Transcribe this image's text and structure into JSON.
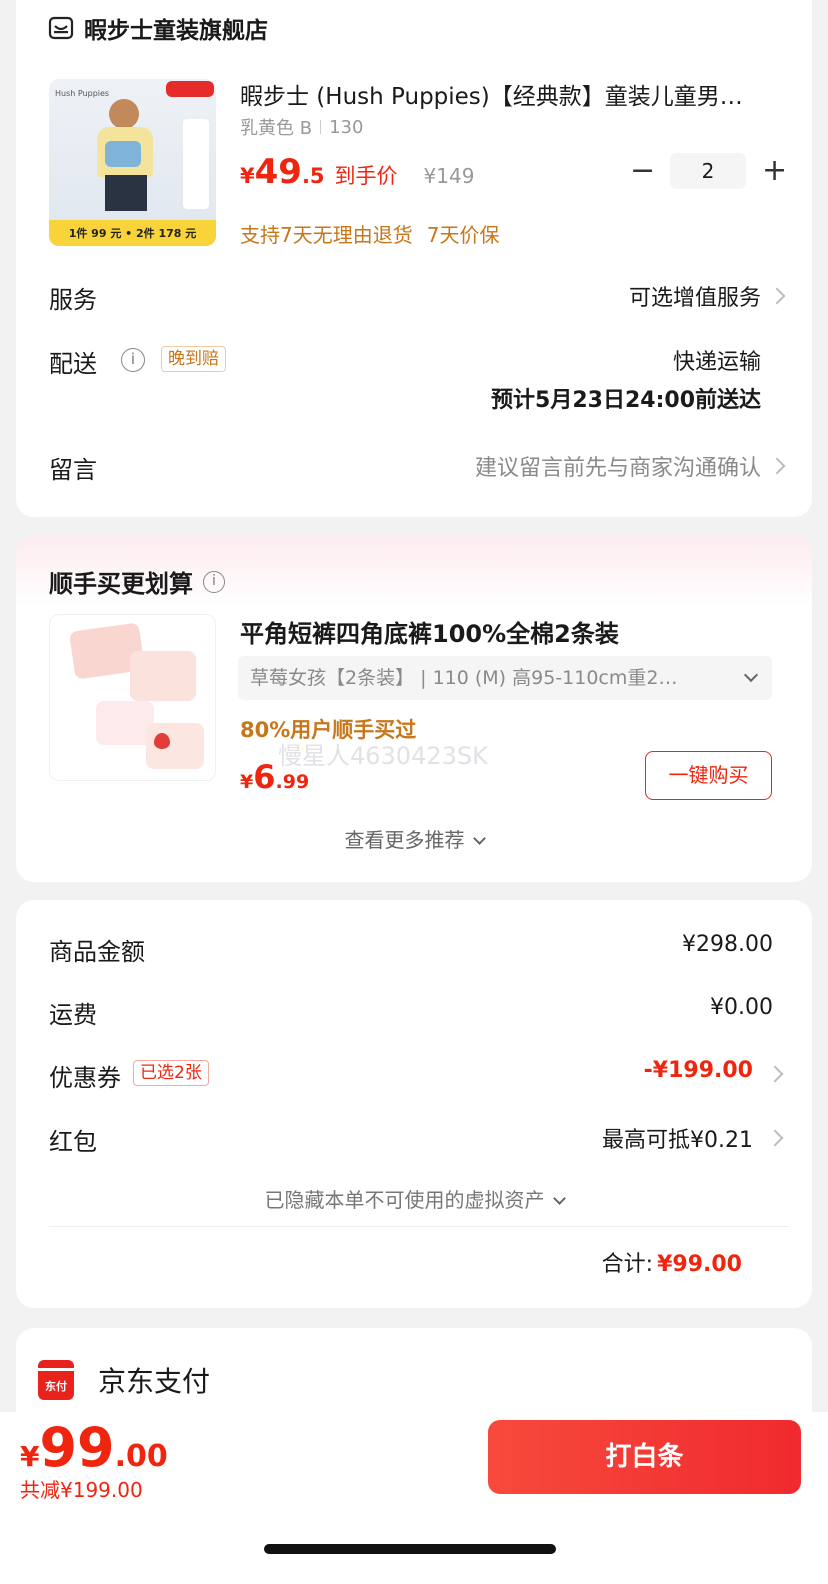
{
  "store": {
    "name": "暇步士童装旗舰店",
    "store_icon": "store-icon"
  },
  "product": {
    "brand_logo_text": "Hush Puppies",
    "promo_text": "1件 99 元 • 2件 178 元",
    "title": "暇步士 (Hush Puppies)【经典款】童装儿童男…",
    "variant": "乳黄色 B",
    "size": "130",
    "price_symbol": "¥",
    "price_int": "49",
    "price_dec": ".5",
    "price_label": "到手价",
    "original_price": "¥149",
    "quantity": "2",
    "qty_minus": "−",
    "qty_plus": "+",
    "guarantee_1": "支持7天无理由退货",
    "guarantee_2": "7天价保"
  },
  "service": {
    "label": "服务",
    "value": "可选增值服务"
  },
  "delivery": {
    "label": "配送",
    "badge": "晚到赔",
    "method": "快递运输",
    "eta": "预计5月23日24:00前送达"
  },
  "message": {
    "label": "留言",
    "placeholder": "建议留言前先与商家沟通确认"
  },
  "addon": {
    "title": "顺手买更划算",
    "product_title": "平角短裤四角底裤100%全棉2条装",
    "spec": "草莓女孩【2条装】 | 110 (M) 高95-110cm重2…",
    "popularity": "80%用户顺手买过",
    "price_symbol": "¥",
    "price_int": "6",
    "price_dec": ".99",
    "buy_button": "一键购买",
    "watermark": "慢星人4630423SK",
    "more": "查看更多推荐"
  },
  "summary": {
    "goods_label": "商品金额",
    "goods_value": "¥298.00",
    "shipping_label": "运费",
    "shipping_value": "¥0.00",
    "coupon_label": "优惠券",
    "coupon_badge": "已选2张",
    "coupon_value": "-¥199.00",
    "redpacket_label": "红包",
    "redpacket_value": "最高可抵¥0.21",
    "hidden_note": "已隐藏本单不可使用的虚拟资产",
    "total_label": "合计:",
    "total_value": "¥99.00"
  },
  "payment": {
    "icon_text": "东付",
    "name": "京东支付"
  },
  "bottom_bar": {
    "price_symbol": "¥",
    "price_int": "99",
    "price_dec": ".00",
    "discount": "共减¥199.00",
    "pay_button": "打白条"
  },
  "colors": {
    "accent_red": "#f0250f",
    "orange": "#c7761a",
    "button_red": "#f52f2a"
  }
}
